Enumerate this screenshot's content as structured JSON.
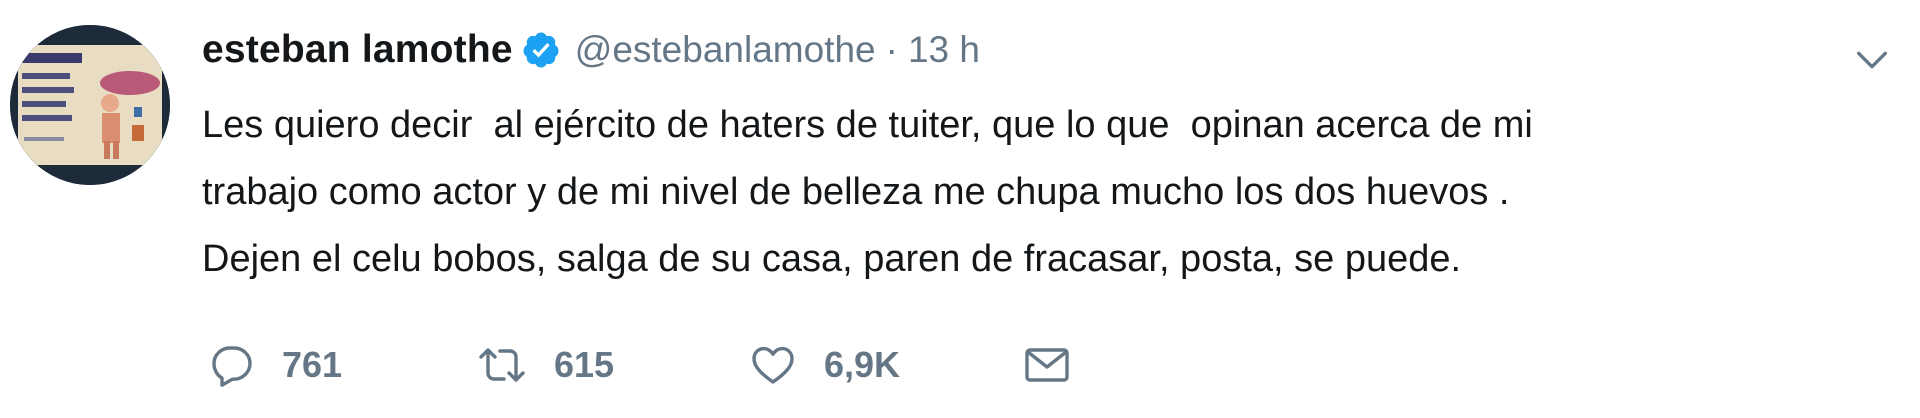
{
  "tweet": {
    "author": {
      "display_name": "esteban lamothe",
      "handle": "@estebanlamothe",
      "verified": true,
      "avatar_icon": "profile-photo"
    },
    "separator": "·",
    "time": "13 h",
    "text_lines": [
      "Les quiero decir  al ejército de haters de tuiter, que lo que  opinan acerca de mi",
      "trabajo como actor y de mi nivel de belleza me chupa mucho los dos huevos .",
      "Dejen el celu bobos, salga de su casa, paren de fracasar, posta, se puede."
    ],
    "actions": {
      "reply": {
        "icon": "reply-icon",
        "count": "761"
      },
      "retweet": {
        "icon": "retweet-icon",
        "count": "615"
      },
      "like": {
        "icon": "heart-icon",
        "count": "6,9K"
      },
      "message": {
        "icon": "envelope-icon"
      }
    },
    "menu_icon": "chevron-down-icon"
  },
  "colors": {
    "text": "#14171a",
    "secondary": "#657786",
    "verified": "#1da1f2"
  }
}
